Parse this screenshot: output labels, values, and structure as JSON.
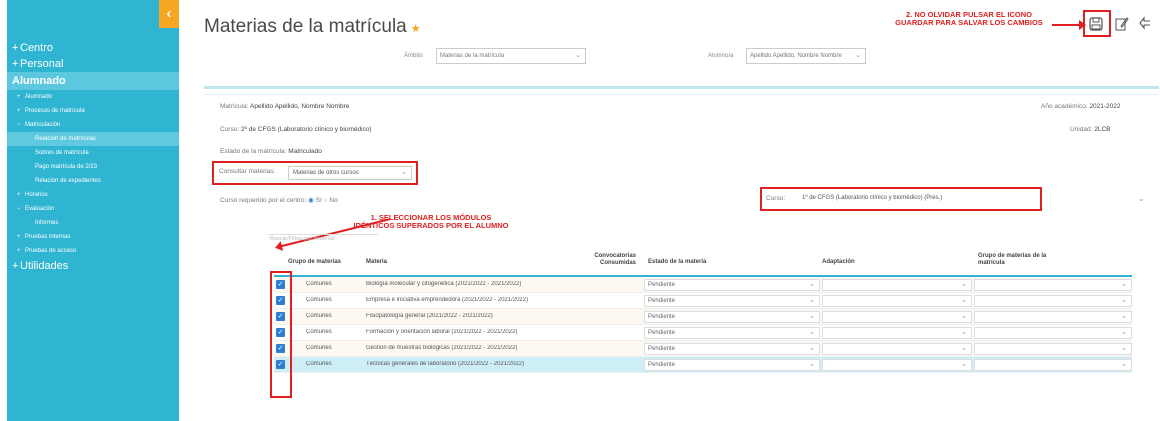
{
  "sidebar": {
    "collapse_icon": "chevron-left-icon",
    "items": [
      {
        "label": "Centro",
        "level": "l1"
      },
      {
        "label": "Personal",
        "level": "l1"
      },
      {
        "label": "Alumnado",
        "level": "hl"
      },
      {
        "label": "Alumnado",
        "level": "l2"
      },
      {
        "label": "Procesos de matrícula",
        "level": "l2"
      },
      {
        "label": "Matriculación",
        "level": "l2"
      },
      {
        "label": "Relación de matrículas",
        "level": "l3"
      },
      {
        "label": "Sobres de matrícula",
        "level": "l3"
      },
      {
        "label": "Pago matrícula de 2/23",
        "level": "l3"
      },
      {
        "label": "Relación de expedientes",
        "level": "l3"
      },
      {
        "label": "Horarios",
        "level": "l2"
      },
      {
        "label": "Evaluación",
        "level": "l2"
      },
      {
        "label": "Informes",
        "level": "l3"
      },
      {
        "label": "Pruebas internas",
        "level": "l2"
      },
      {
        "label": "Pruebas de acceso",
        "level": "l2"
      },
      {
        "label": "Utilidades",
        "level": "l1"
      }
    ]
  },
  "page": {
    "title": "Materias de la matrícula",
    "star_icon": "★"
  },
  "toolbar": {
    "save_icon": "save-icon",
    "edit_icon": "edit-icon",
    "back_icon": "back-icon"
  },
  "annotations": {
    "top_note": "2. NO OLVIDAR PULSAR EL ICONO GUARDAR PARA SALVAR LOS CAMBIOS",
    "mid_note": "1. SELECCIONAR LOS MÓDULOS IDÉNTICOS SUPERADOS POR EL ALUMNO",
    "color": "#e02020"
  },
  "filters": {
    "ambito_label": "Ámbito",
    "ambito_value": "Materias de la matrícula",
    "alumno_label": "Alumno/a",
    "alumno_value": "Apellido Apellido, Nombre Nombre"
  },
  "info": {
    "matricula_label": "Matrícula:",
    "matricula_value": "Apellido Apellido, Nombre Nombre",
    "curso_label": "Curso:",
    "curso_value": "2º de CFGS (Laboratorio clínico y biomédico)",
    "estado_label": "Estado de la matrícula:",
    "estado_value": "Matriculado",
    "anio_label": "Año académico:",
    "anio_value": "2021-2022",
    "unidad_label": "Unidad:",
    "unidad_value": "2LCB",
    "consultar_label": "Consultar materias:",
    "consultar_value": "Materias de otros cursos",
    "curso_sel_label": "Curso:",
    "curso_sel_value": "1º de CFGS (Laboratorio clínico y biomédico) (Pres.)",
    "req_label": "Curso requerido por el centro:",
    "radio_si": "Sí",
    "radio_no": "No"
  },
  "table": {
    "search_hint": "Buscar/Filtrar por materias",
    "headers": {
      "grupo": "Grupo de materias",
      "materia": "Materia",
      "convocatorias": "Convocatorias Consumidas",
      "estado": "Estado de la materia",
      "adaptacion": "Adaptación",
      "grupo_matricula": "Grupo de materias de la matrícula"
    },
    "rows": [
      {
        "grupo": "Comunes",
        "materia": "Biología molecular y citogenética (2021/2022 - 2021/2022)",
        "estado": "Pendiente"
      },
      {
        "grupo": "Comunes",
        "materia": "Empresa e iniciativa emprendedora (2021/2022 - 2021/2022)",
        "estado": "Pendiente"
      },
      {
        "grupo": "Comunes",
        "materia": "Fisiopatología general (2021/2022 - 2021/2022)",
        "estado": "Pendiente"
      },
      {
        "grupo": "Comunes",
        "materia": "Formación y orientación laboral (2021/2022 - 2021/2022)",
        "estado": "Pendiente"
      },
      {
        "grupo": "Comunes",
        "materia": "Gestión de muestras biológicas (2021/2022 - 2021/2022)",
        "estado": "Pendiente"
      },
      {
        "grupo": "Comunes",
        "materia": "Técnicas generales de laboratorio (2021/2022 - 2021/2022)",
        "estado": "Pendiente"
      }
    ]
  }
}
